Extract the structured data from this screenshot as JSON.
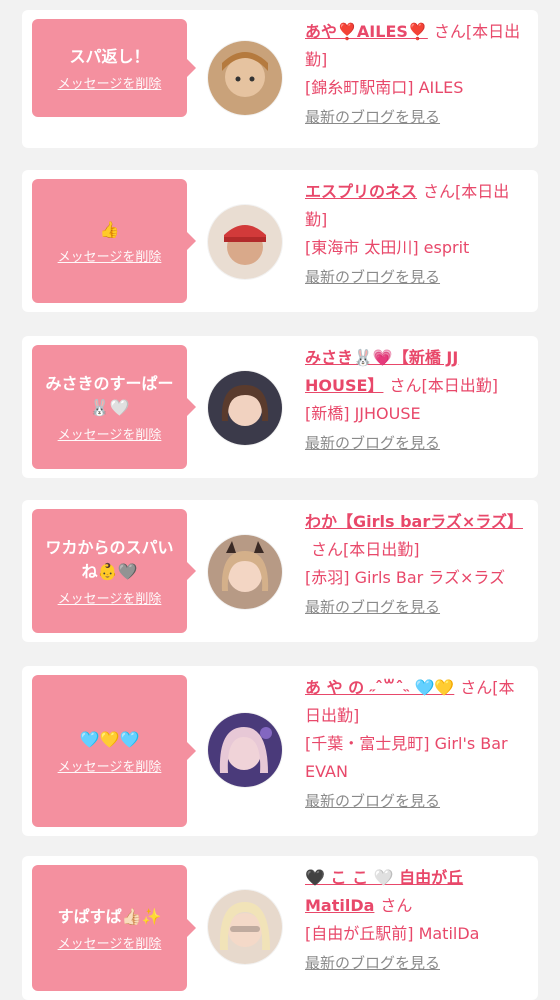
{
  "delete_label": "メッセージを削除",
  "blog_label": "最新のブログを見る",
  "cards": [
    {
      "message": "スパ返し！",
      "name": "あや❣️AILES❣️",
      "san_status": "さん[本日出勤]",
      "shop": "[錦糸町駅南口] AILES"
    },
    {
      "message": "👍",
      "name": "エスプリのネス",
      "san_status": "さん[本日出勤]",
      "shop": "[東海市 太田川] esprit"
    },
    {
      "message": "みさきのすーぱー🐰🤍",
      "name": "みさき🐰💗【新橋 JJ HOUSE】",
      "san_status": "さん[本日出勤]",
      "shop": "[新橋] JJHOUSE"
    },
    {
      "message": "ワカからのスパいね👶🩶",
      "name": "わか【Girls barラズ×ラズ】",
      "san_status": "さん[本日出勤]",
      "shop": "[赤羽] Girls Bar ラズ×ラズ"
    },
    {
      "message": "🩵💛🩵",
      "name": "あ や の ˶ˆ꒳ˆ˵ 🩵💛",
      "san_status": "さん[本日出勤]",
      "shop": "[千葉・富士見町] Girl's Bar EVAN"
    },
    {
      "message": "すぱすぱ👍🏻✨",
      "name": "🖤 こ こ 🤍 自由が丘 MatilDa",
      "san_status": "さん",
      "shop": "[自由が丘駅前] MatilDa"
    }
  ]
}
